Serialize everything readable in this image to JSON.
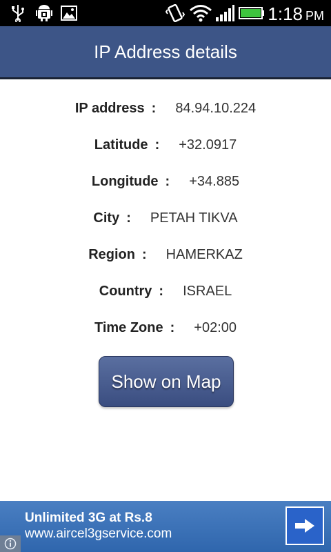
{
  "statusbar": {
    "time": "1:18",
    "ampm": "PM",
    "icons": [
      "usb-icon",
      "android-debug-icon",
      "image-icon",
      "vibrate-icon",
      "wifi-icon",
      "signal-icon",
      "battery-icon"
    ]
  },
  "header": {
    "title": "IP Address details"
  },
  "details": [
    {
      "label": "IP address",
      "sep": ":",
      "value": "84.94.10.224"
    },
    {
      "label": "Latitude",
      "sep": ":",
      "value": "+32.0917"
    },
    {
      "label": "Longitude",
      "sep": ":",
      "value": "+34.885"
    },
    {
      "label": "City",
      "sep": ":",
      "value": "PETAH TIKVA"
    },
    {
      "label": "Region",
      "sep": ":",
      "value": "HAMERKAZ"
    },
    {
      "label": "Country",
      "sep": ":",
      "value": "ISRAEL"
    },
    {
      "label": "Time Zone",
      "sep": ":",
      "value": "+02:00"
    }
  ],
  "actions": {
    "show_on_map": "Show on Map"
  },
  "ad": {
    "title": "Unlimited 3G at Rs.8",
    "url": "www.aircel3gservice.com"
  },
  "colors": {
    "header_bg": "#3d5587",
    "button_bg": "#3a4d80",
    "ad_bg": "#3f76bb",
    "battery_green": "#3ec43e"
  }
}
